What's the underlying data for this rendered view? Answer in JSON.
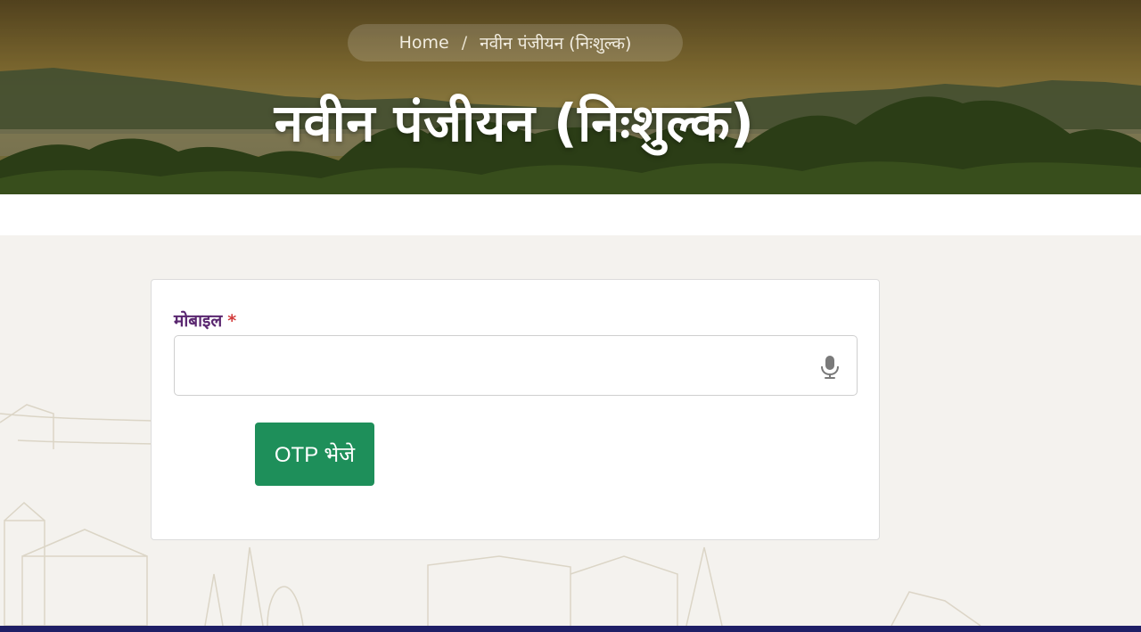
{
  "breadcrumb": {
    "home_label": "Home",
    "separator": "/",
    "current_label": "नवीन पंजीयन (निःशुल्क)"
  },
  "page": {
    "title": "नवीन पंजीयन (निःशुल्क)"
  },
  "form": {
    "mobile_label": "मोबाइल",
    "required_marker": "*",
    "mobile_value": "",
    "mobile_placeholder": "",
    "mic_icon": "microphone-icon",
    "otp_button_label": "OTP भेजे"
  },
  "colors": {
    "primary_button": "#1e8f5a",
    "label_purple": "#5a2770",
    "required_red": "#d23b3b",
    "footer_bar": "#1f1f66"
  }
}
